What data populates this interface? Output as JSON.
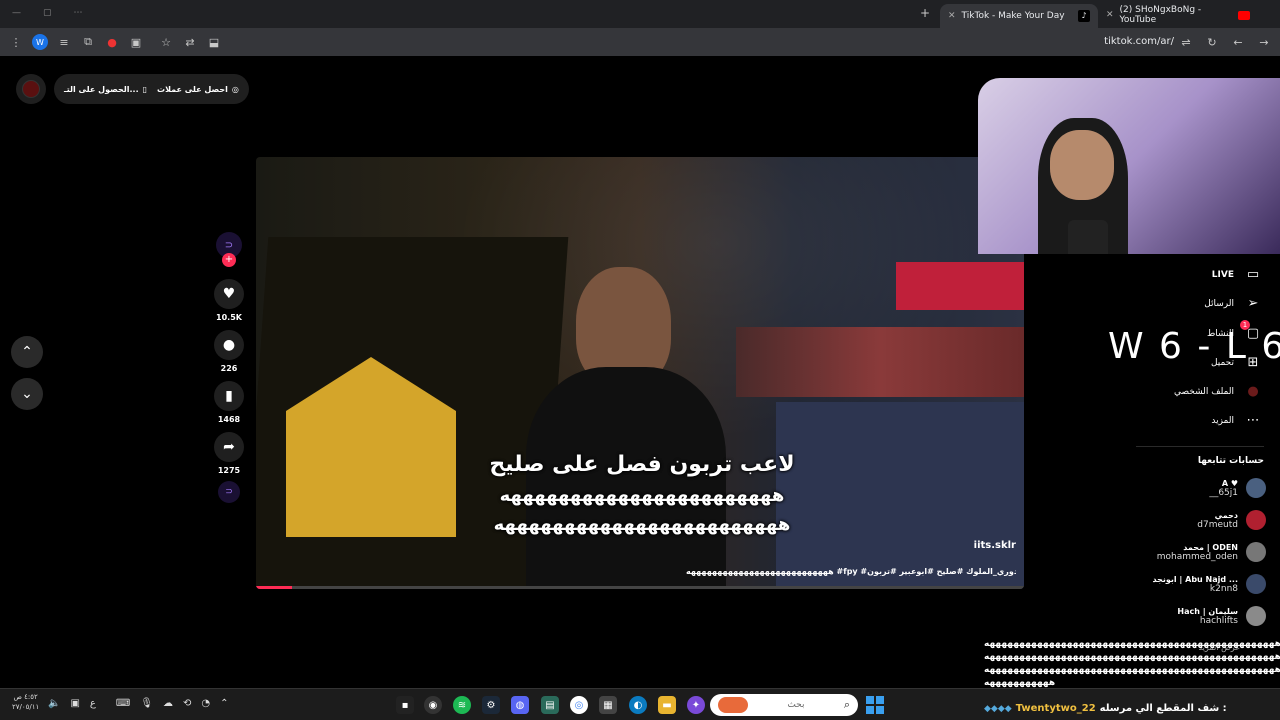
{
  "browser": {
    "tabs": [
      {
        "label": "TikTok - Make Your Day",
        "active": true
      },
      {
        "label": "(2) SHoNgxBoNg - YouTube",
        "active": false
      }
    ],
    "new_tab": "+",
    "url": "tiktok.com/ar/",
    "colors": {
      "tabbar": "#202124",
      "toolbar": "#35363a"
    }
  },
  "top_pill": {
    "coins": "احصل على عملات",
    "app": "الحصول على التـ..."
  },
  "video": {
    "caption_line1": "لاعب تربون فصل على صليح",
    "caption_line2": "هههههههههههههههههههههههه",
    "caption_line3": "ههههههههههههههههههههههههه",
    "watermark": "iits.sklr",
    "description": "هههههههههههههههههههههههههههه #fpy #دوري_الملوك #صليح #ابوعبير #تربون"
  },
  "actions": {
    "likes": "10.5K",
    "comments": "226",
    "saves": "1468",
    "shares": "1275"
  },
  "nav": {
    "live": "LIVE",
    "messages": "الرسائل",
    "activity": "النشاط",
    "upload": "تحميل",
    "profile": "الملف الشخصي",
    "more": "المزيد",
    "activity_badge": "1"
  },
  "score_overlay": "W 6 - L 6",
  "following": {
    "heading": "حسابات تتابعها",
    "accounts": [
      {
        "name": "A ♥",
        "user": "__65j1"
      },
      {
        "name": "دحمي",
        "user": "d7meutd"
      },
      {
        "name": "محمد | ODEN",
        "user": "mohammed_oden"
      },
      {
        "name": "ابونجد | Abu Najd ...",
        "user": "k2nn8"
      },
      {
        "name": "Hach | سليمان",
        "user": "hachlifts"
      }
    ],
    "see_more": "عرض المزيد"
  },
  "chat": {
    "line1": "هههههههههههههههههههههههههههههههههههههههههههههههههه",
    "line2": "هههههههههههههههههههههههههههههههههههههههههههههههههه",
    "line3": "هههههههههههههههههههههههههههههههههههههههههههههههههه",
    "line4": "هههههههههههه",
    "username": "Twentytwo_22",
    "message": "شف المقطع الي مرسله :"
  },
  "taskbar": {
    "search_placeholder": "بحث",
    "time": "٤:٥٢ ص",
    "date": "٢٧/٠٥/١١",
    "lang": "ع"
  }
}
